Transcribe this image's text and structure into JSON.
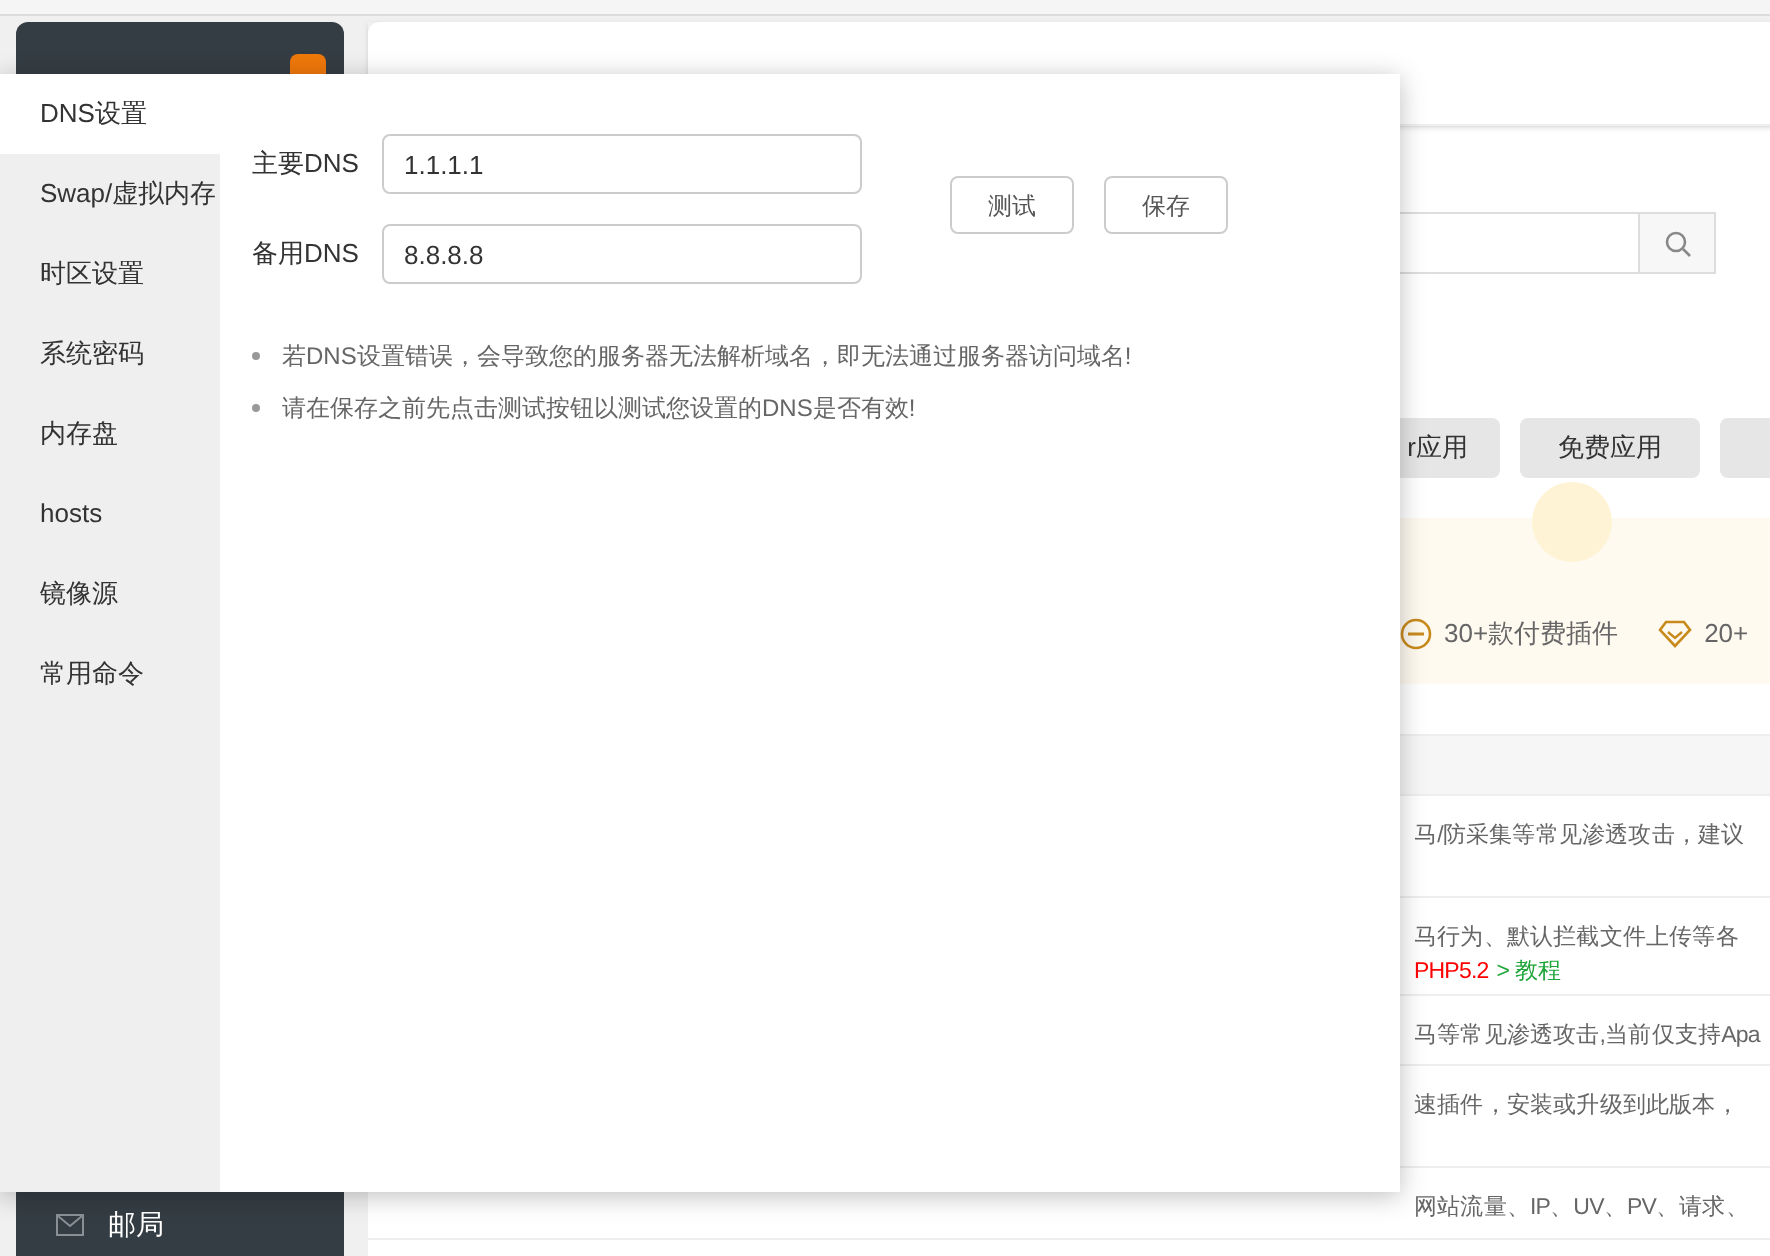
{
  "dialog": {
    "menu": [
      {
        "label": "DNS设置",
        "selected": true
      },
      {
        "label": "Swap/虚拟内存",
        "selected": false
      },
      {
        "label": "时区设置",
        "selected": false
      },
      {
        "label": "系统密码",
        "selected": false
      },
      {
        "label": "内存盘",
        "selected": false
      },
      {
        "label": "hosts",
        "selected": false
      },
      {
        "label": "镜像源",
        "selected": false
      },
      {
        "label": "常用命令",
        "selected": false
      }
    ],
    "fields": [
      {
        "label": "主要DNS",
        "value": "1.1.1.1"
      },
      {
        "label": "备用DNS",
        "value": "8.8.8.8"
      }
    ],
    "buttons": [
      "测试",
      "保存"
    ],
    "notes": [
      "若DNS设置错误，会导致您的服务器无法解析域名，即无法通过服务器访问域名!",
      "请在保存之前先点击测试按钮以测试您设置的DNS是否有效!"
    ]
  },
  "background": {
    "filters": [
      "r应用",
      "免费应用"
    ],
    "features": [
      "30+款付费插件",
      "20+"
    ],
    "rows": [
      {
        "parts": [
          {
            "kind": "plain",
            "text": "马/防采集等常见渗透攻击，建议"
          }
        ]
      },
      {
        "parts": [
          {
            "kind": "plain",
            "text": "马行为、默认拦截文件上传等各"
          }
        ],
        "extra": [
          {
            "kind": "warning",
            "text": "PHP5.2"
          },
          {
            "kind": "link",
            "text": "> 教程"
          }
        ]
      },
      {
        "parts": [
          {
            "kind": "plain",
            "text": "马等常见渗透攻击,当前仅支持Apa"
          }
        ]
      },
      {
        "parts": [
          {
            "kind": "plain",
            "text": "速插件，安装或升级到此版本，"
          }
        ]
      },
      {
        "parts": [
          {
            "kind": "plain",
            "text": "网站流量、IP、UV、PV、请求、"
          }
        ]
      }
    ],
    "sidebar_item": "邮局"
  }
}
